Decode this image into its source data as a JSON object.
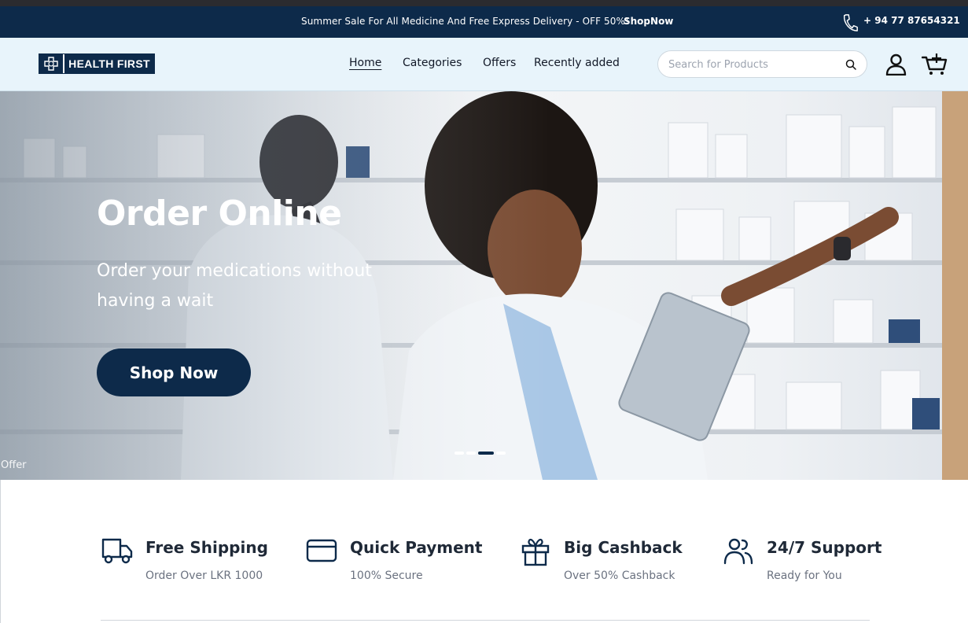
{
  "announcement": {
    "message": "Summer Sale For All Medicine And Free Express Delivery - OFF 50%!",
    "link_label": "ShopNow",
    "phone": "+ 94 77 87654321",
    "phone_icon": "phone-icon"
  },
  "header": {
    "logo_text": "HEALTH FIRST",
    "logo_icon": "medical-cross-icon",
    "nav": [
      "Home",
      "Categories",
      "Offers",
      "Recently added"
    ],
    "active_nav": "Home",
    "search_placeholder": "Search for Products",
    "search_icon": "search-icon",
    "user_icon": "user-icon",
    "cart_icon": "cart-icon"
  },
  "hero": {
    "title": "Order Online",
    "subtitle": "Order your medications without having a wait",
    "cta_label": "Shop Now",
    "corner_label": "Offer",
    "slides_count": 4,
    "active_slide": 3
  },
  "features": [
    {
      "icon": "truck-icon",
      "title": "Free Shipping",
      "subtitle": "Order Over LKR 1000"
    },
    {
      "icon": "credit-card-icon",
      "title": "Quick Payment",
      "subtitle": "100% Secure"
    },
    {
      "icon": "gift-icon",
      "title": "Big Cashback",
      "subtitle": "Over 50% Cashback"
    },
    {
      "icon": "users-icon",
      "title": "24/7 Support",
      "subtitle": "Ready for You"
    }
  ],
  "colors": {
    "brand_navy": "#0d2a4a",
    "header_bg": "#e8f4fb",
    "top_strip": "#2b2b2f"
  }
}
